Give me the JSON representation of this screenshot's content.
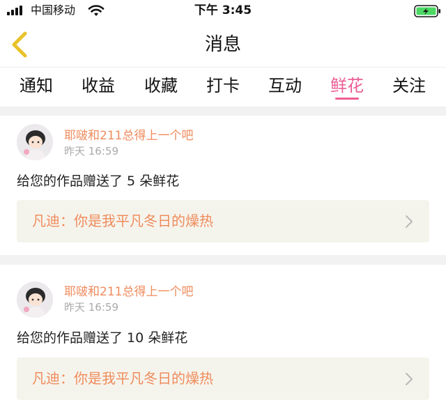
{
  "status": {
    "carrier": "中国移动",
    "time": "下午 3:45"
  },
  "nav": {
    "title": "消息"
  },
  "tabs": [
    {
      "label": "通知"
    },
    {
      "label": "收益"
    },
    {
      "label": "收藏"
    },
    {
      "label": "打卡"
    },
    {
      "label": "互动"
    },
    {
      "label": "鲜花"
    },
    {
      "label": "关注"
    }
  ],
  "active_tab": "鲜花",
  "messages": [
    {
      "sender": "耶啵和211总得上一个吧",
      "time": "昨天 16:59",
      "text": "给您的作品赠送了 5 朵鲜花",
      "quote": "凡迪：你是我平凡冬日的燥热"
    },
    {
      "sender": "耶啵和211总得上一个吧",
      "time": "昨天 16:59",
      "text": "给您的作品赠送了 10 朵鲜花",
      "quote": "凡迪：你是我平凡冬日的燥热"
    }
  ],
  "colors": {
    "accent": "#ec5d95",
    "sender": "#ef8b5c",
    "back_icon": "#e8c22a",
    "battery": "#4cd964"
  },
  "icons": {
    "back": "chevron-left-icon",
    "row_action": "chevron-right-icon",
    "signal": "signal-icon",
    "wifi": "wifi-icon",
    "battery": "battery-charging-icon"
  }
}
